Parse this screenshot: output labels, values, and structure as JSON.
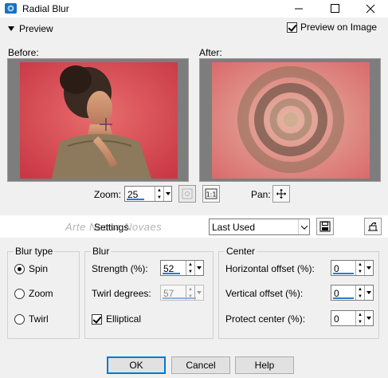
{
  "window": {
    "title": "Radial Blur"
  },
  "preview": {
    "toggle_label": "Preview",
    "on_image_label": "Preview on Image",
    "on_image_checked": true
  },
  "panes": {
    "before_label": "Before:",
    "after_label": "After:"
  },
  "zoom": {
    "label": "Zoom:",
    "value": "25",
    "pan_label": "Pan:"
  },
  "settings": {
    "label": "Settings",
    "preset": "Last Used",
    "watermark": "Arte Neusa Novaes"
  },
  "blur_type": {
    "title": "Blur type",
    "options": [
      {
        "label": "Spin",
        "selected": true
      },
      {
        "label": "Zoom",
        "selected": false
      },
      {
        "label": "Twirl",
        "selected": false
      }
    ]
  },
  "blur": {
    "title": "Blur",
    "strength_label": "Strength (%):",
    "strength_value": "52",
    "twirl_label": "Twirl degrees:",
    "twirl_value": "57",
    "elliptical_label": "Elliptical",
    "elliptical_checked": true
  },
  "center": {
    "title": "Center",
    "h_label": "Horizontal offset (%):",
    "h_value": "0",
    "v_label": "Vertical offset (%):",
    "v_value": "0",
    "protect_label": "Protect center (%):",
    "protect_value": "0"
  },
  "buttons": {
    "ok": "OK",
    "cancel": "Cancel",
    "help": "Help"
  },
  "colors": {
    "accent": "#0078d7",
    "spin_underline": "#2b79d6",
    "image_bg": "#d5495a"
  }
}
